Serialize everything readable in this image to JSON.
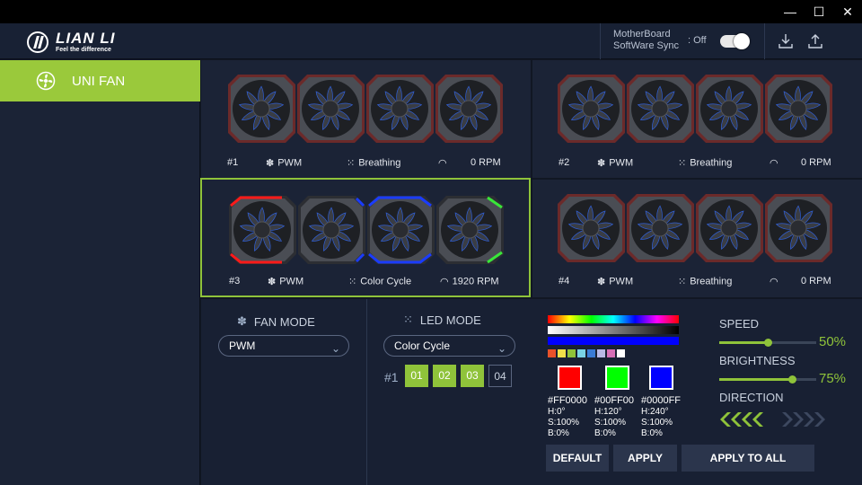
{
  "window": {
    "minimize": "—",
    "maximize": "☐",
    "close": "✕"
  },
  "header": {
    "logo_name": "LIAN LI",
    "logo_tagline": "Feel the difference",
    "sync_label_line1": "MotherBoard",
    "sync_label_line2": "SoftWare Sync",
    "sync_state": ": Off",
    "import_icon": "download-icon",
    "export_icon": "upload-icon"
  },
  "sidebar": {
    "items": [
      {
        "label": "UNI FAN",
        "icon": "fan-icon",
        "active": true
      }
    ]
  },
  "groups": [
    {
      "id": "#1",
      "fan_mode": "PWM",
      "led_mode": "Breathing",
      "rpm": "0 RPM",
      "selected": false
    },
    {
      "id": "#2",
      "fan_mode": "PWM",
      "led_mode": "Breathing",
      "rpm": "0 RPM",
      "selected": false
    },
    {
      "id": "#3",
      "fan_mode": "PWM",
      "led_mode": "Color Cycle",
      "rpm": "1920 RPM",
      "selected": true
    },
    {
      "id": "#4",
      "fan_mode": "PWM",
      "led_mode": "Breathing",
      "rpm": "0 RPM",
      "selected": false
    }
  ],
  "controls": {
    "fan_mode_title": "FAN MODE",
    "fan_mode_value": "PWM",
    "led_mode_title": "LED MODE",
    "led_mode_value": "Color Cycle",
    "group_label": "#1",
    "fan_buttons": [
      {
        "label": "01",
        "active": true
      },
      {
        "label": "02",
        "active": true
      },
      {
        "label": "03",
        "active": true
      },
      {
        "label": "04",
        "active": false
      }
    ],
    "palette": [
      "#e8522a",
      "#f0e04a",
      "#8fc33a",
      "#79d3e6",
      "#3a7bd5",
      "#b9b9e6",
      "#d66fb6",
      "#ffffff"
    ],
    "colors": [
      {
        "hex": "#FF0000",
        "h": "H:0°",
        "s": "S:100%",
        "b": "B:0%"
      },
      {
        "hex": "#00FF00",
        "h": "H:120°",
        "s": "S:100%",
        "b": "B:0%"
      },
      {
        "hex": "#0000FF",
        "h": "H:240°",
        "s": "S:100%",
        "b": "B:0%"
      }
    ],
    "default_label": "DEFAULT",
    "apply_label": "APPLY",
    "apply_all_label": "APPLY TO ALL",
    "speed_label": "SPEED",
    "speed_value": "50%",
    "speed_level": 0.5,
    "brightness_label": "BRIGHTNESS",
    "brightness_value": "75%",
    "brightness_level": 0.75,
    "direction_label": "DIRECTION"
  },
  "colors": {
    "accent": "#8fc33a",
    "fan_frame": "#6b2a2a",
    "led_red": "#ff1a1a",
    "led_blue": "#1a3cff",
    "led_green": "#39e639"
  }
}
